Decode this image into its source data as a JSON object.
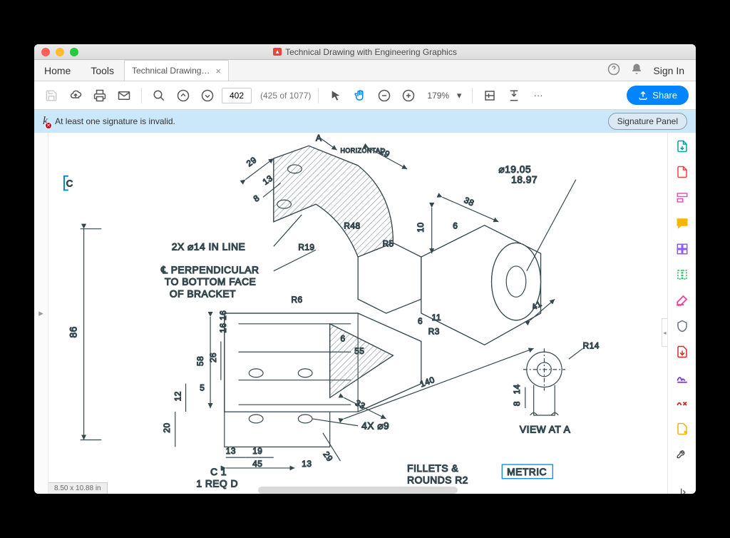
{
  "window": {
    "title": "Technical Drawing with Engineering Graphics"
  },
  "menu": {
    "home": "Home",
    "tools": "Tools",
    "signin": "Sign In"
  },
  "tab": {
    "label": "Technical Drawing…"
  },
  "toolbar": {
    "page_value": "402",
    "page_total": "(425 of 1077)",
    "zoom": "179%",
    "share": "Share"
  },
  "sig": {
    "message": "At least one signature is invalid.",
    "panel_btn": "Signature Panel"
  },
  "drawing": {
    "callouts": {
      "holes_line": "2X ⌀14  IN LINE",
      "perp1": "℄ PERPENDICULAR",
      "perp2": "TO BOTTOM FACE",
      "perp3": "OF BRACKET",
      "four_holes": "4X ⌀9",
      "diameter1": "⌀19.05",
      "diameter2": "18.97",
      "r14": "R14",
      "r3": "R3",
      "r5": "R5",
      "r6": "R6",
      "r19": "R19",
      "r48": "R48",
      "horizontal": "HORIZONTAL",
      "view": "VIEW AT A",
      "metric": "METRIC",
      "fillets1": "FILLETS &",
      "fillets2": "ROUNDS R2",
      "part_id": "C 1",
      "part_qty": "1  REQ D",
      "a_arrow": "A"
    },
    "dims": {
      "d86": "86",
      "d29a": "29",
      "d29b": "29",
      "d29c": "29",
      "d13a": "13",
      "d8": "8",
      "d38": "38",
      "d10": "10",
      "d6a": "6",
      "d16a": "16",
      "d58": "58",
      "d26": "26",
      "d16b": "16",
      "d41": "41",
      "d6b": "6",
      "d11": "11",
      "d55": "55",
      "d33": "33",
      "d140": "140",
      "d45": "45",
      "d19": "19",
      "d13b": "13",
      "d13c": "13",
      "d12": "12",
      "d20": "20",
      "d5": "5",
      "d8b": "8",
      "d14": "14",
      "d6c": "6"
    }
  },
  "status": {
    "page_size": "8.50 x 10.88 in"
  }
}
